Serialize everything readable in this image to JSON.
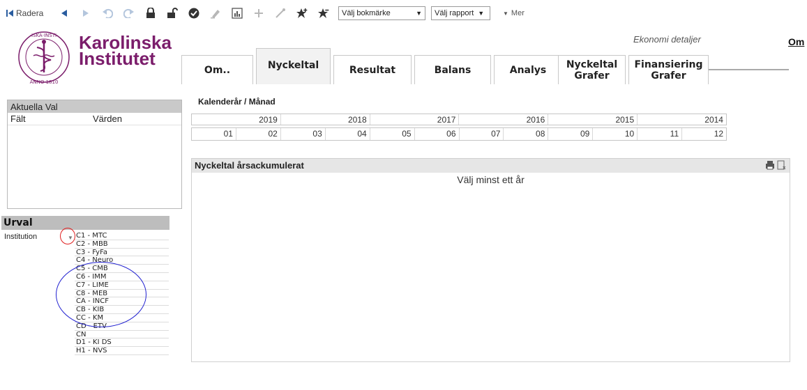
{
  "toolbar": {
    "radera_label": "Radera",
    "bookmark_select": "Välj bokmärke",
    "report_select": "Välj rapport",
    "mer_label": "Mer"
  },
  "logo": {
    "line1": "Karolinska",
    "line2": "Institutet"
  },
  "header": {
    "economy_detail": "Ekonomi detaljer",
    "om_link": "Om"
  },
  "tabs": [
    {
      "label": "Om..",
      "active": false
    },
    {
      "label": "Nyckeltal",
      "active": true
    },
    {
      "label": "Resultat",
      "active": false
    },
    {
      "label": "Balans",
      "active": false
    },
    {
      "label": "Analys",
      "active": false
    },
    {
      "label": "Nyckeltal Grafer",
      "active": false
    },
    {
      "label": "Finansiering Grafer",
      "active": false
    }
  ],
  "current_selections": {
    "title": "Aktuella Val",
    "col_field": "Fält",
    "col_values": "Värden"
  },
  "urval": {
    "title": "Urval",
    "institution_label": "Institution",
    "items": [
      "C1 - MTC",
      "C2 - MBB",
      "C3 - FyFa",
      "C4 - Neuro",
      "C5 - CMB",
      "C6 - IMM",
      "C7 - LIME",
      "C8 - MEB",
      "CA - INCF",
      "CB - KIB",
      "CC - KM",
      "CD - ETV",
      "CN",
      "D1 - KI DS",
      "H1 - NVS"
    ]
  },
  "calendar": {
    "label": "Kalenderår / Månad",
    "years": [
      "2019",
      "2018",
      "2017",
      "2016",
      "2015",
      "2014"
    ],
    "months": [
      "01",
      "02",
      "03",
      "04",
      "05",
      "06",
      "07",
      "08",
      "09",
      "10",
      "11",
      "12"
    ]
  },
  "panel": {
    "title": "Nyckeltal årsackumulerat",
    "message": "Välj minst ett år"
  },
  "colors": {
    "brand": "#7b1d6b",
    "annotation_red": "#e02020",
    "annotation_blue": "#2020d0"
  }
}
